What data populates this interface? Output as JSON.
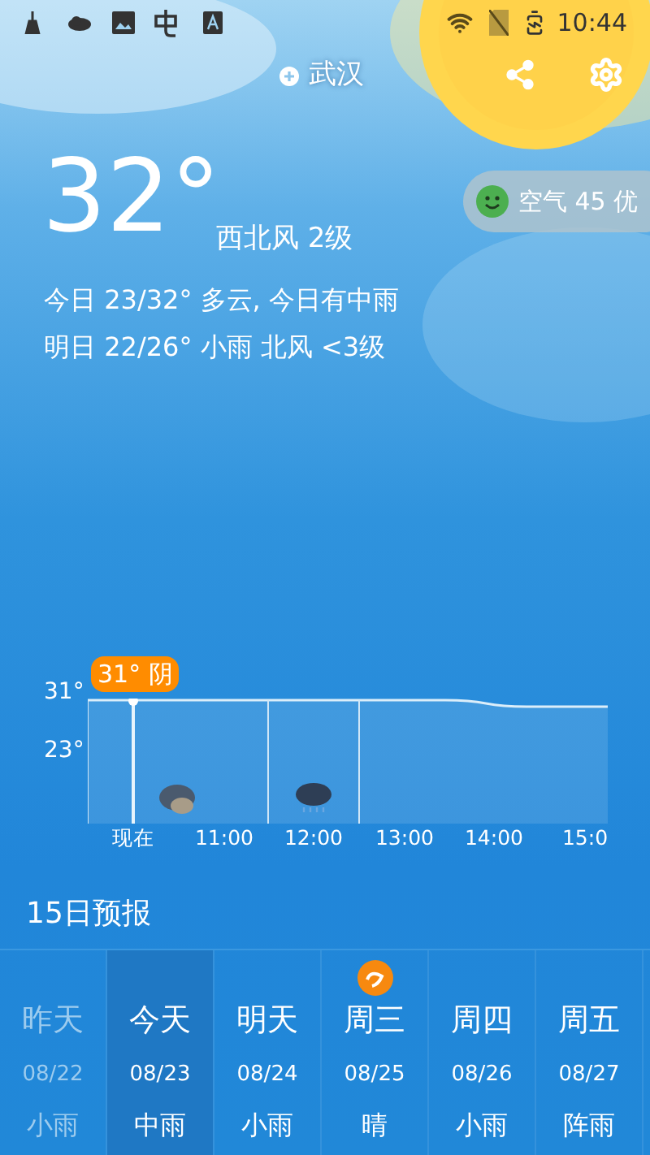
{
  "status_bar": {
    "time": "10:44"
  },
  "header": {
    "city": "武汉"
  },
  "current": {
    "temperature": "32°",
    "wind": "西北风 2级",
    "today": "今日 23/32° 多云, 今日有中雨",
    "tomorrow": "明日 22/26° 小雨 北风 <3级"
  },
  "air_quality": {
    "label": "空气 45 优",
    "color": "#4caf50"
  },
  "hourly": {
    "now_badge": "31° 阴",
    "y_labels": [
      "31°",
      "23°"
    ],
    "hours": [
      {
        "label": "现在",
        "kind": "cloudy"
      },
      {
        "label": "11:00",
        "kind": "none"
      },
      {
        "label": "12:00",
        "kind": "rain"
      },
      {
        "label": "13:00",
        "kind": "none"
      },
      {
        "label": "14:00",
        "kind": "none"
      },
      {
        "label": "15:0",
        "kind": "none"
      }
    ]
  },
  "forecast": {
    "title": "15日预报",
    "days": [
      {
        "day": "昨天",
        "date": "08/22",
        "weather": "小雨",
        "past": true,
        "selected": false,
        "badge": false
      },
      {
        "day": "今天",
        "date": "08/23",
        "weather": "中雨",
        "past": false,
        "selected": true,
        "badge": false
      },
      {
        "day": "明天",
        "date": "08/24",
        "weather": "小雨",
        "past": false,
        "selected": false,
        "badge": false
      },
      {
        "day": "周三",
        "date": "08/25",
        "weather": "晴",
        "past": false,
        "selected": false,
        "badge": true
      },
      {
        "day": "周四",
        "date": "08/26",
        "weather": "小雨",
        "past": false,
        "selected": false,
        "badge": false
      },
      {
        "day": "周五",
        "date": "08/27",
        "weather": "阵雨",
        "past": false,
        "selected": false,
        "badge": false
      }
    ]
  }
}
